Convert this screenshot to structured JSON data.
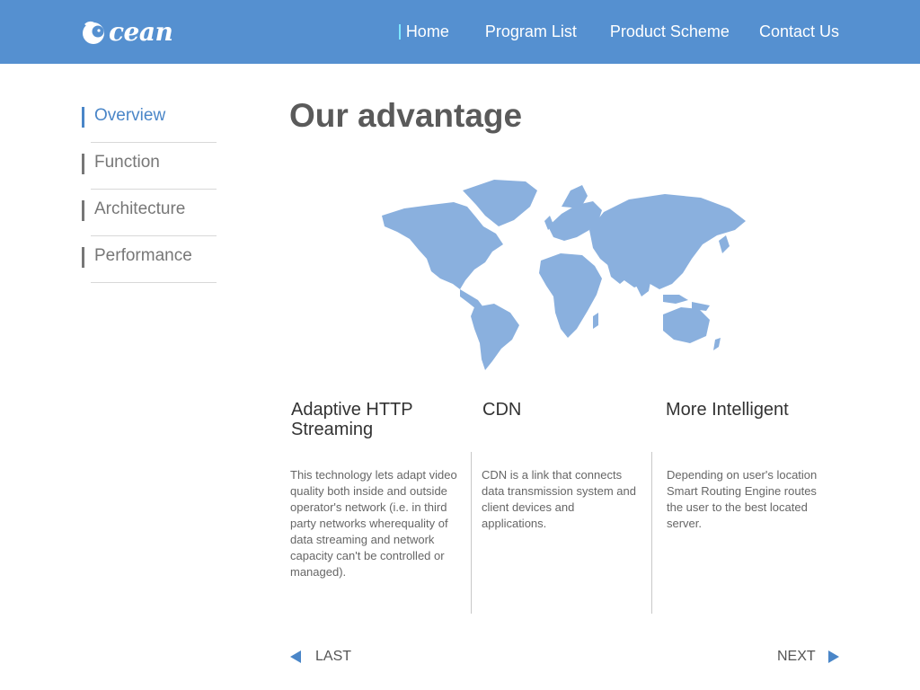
{
  "header": {
    "logo_text": "cean",
    "nav": [
      "Home",
      "Program List",
      "Product Scheme",
      "Contact Us"
    ],
    "background_color": "#5590d0"
  },
  "sidebar": {
    "items": [
      {
        "label": "Overview",
        "active": true
      },
      {
        "label": "Function",
        "active": false
      },
      {
        "label": "Architecture",
        "active": false
      },
      {
        "label": "Performance",
        "active": false
      }
    ],
    "active_color": "#4a86c8"
  },
  "main": {
    "title": "Our advantage",
    "features": [
      {
        "title": "Adaptive HTTP Streaming",
        "description": "This technology lets adapt video quality both inside and outside operator's network (i.e. in third party networks wherequality of data streaming and network capacity can't be controlled or managed)."
      },
      {
        "title": "CDN",
        "description": "CDN is a link that connects data transmission system and client devices and applications."
      },
      {
        "title": "More Intelligent",
        "description": "Depending on user's location Smart Routing Engine routes the user to the best located server."
      }
    ],
    "map_color": "#8ab0de"
  },
  "pager": {
    "last_label": "LAST",
    "next_label": "NEXT"
  }
}
